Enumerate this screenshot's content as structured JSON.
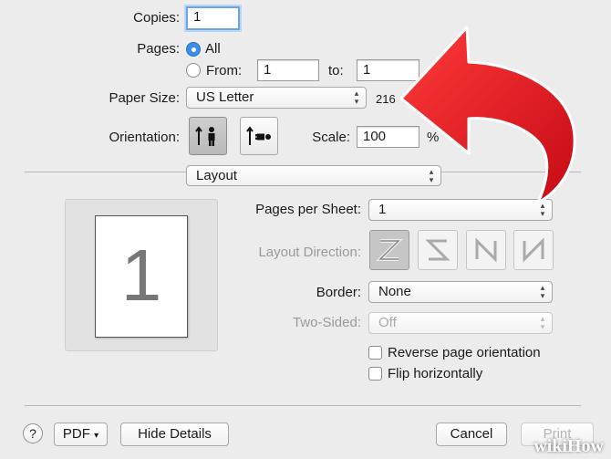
{
  "copies": {
    "label": "Copies:",
    "value": "1"
  },
  "pages": {
    "label": "Pages:",
    "all_label": "All",
    "from_label": "From:",
    "from_value": "1",
    "to_label": "to:",
    "to_value": "1"
  },
  "paper_size": {
    "label": "Paper Size:",
    "value": "US Letter",
    "dims_text": "216"
  },
  "orientation": {
    "label": "Orientation:",
    "selected": "portrait"
  },
  "scale": {
    "label": "Scale:",
    "value": "100",
    "unit": "%"
  },
  "section_popup": {
    "value": "Layout"
  },
  "preview": {
    "page_number": "1"
  },
  "layout": {
    "pages_per_sheet": {
      "label": "Pages per Sheet:",
      "value": "1"
    },
    "layout_direction": {
      "label": "Layout Direction:"
    },
    "border": {
      "label": "Border:",
      "value": "None"
    },
    "two_sided": {
      "label": "Two-Sided:",
      "value": "Off"
    },
    "reverse": {
      "label": "Reverse page orientation",
      "checked": false
    },
    "flip": {
      "label": "Flip horizontally",
      "checked": false
    }
  },
  "footer": {
    "help_label": "?",
    "pdf_label": "PDF",
    "hide_details_label": "Hide Details",
    "cancel_label": "Cancel",
    "print_label": "Print"
  },
  "watermark": "wikiHow",
  "colors": {
    "accent_blue": "#3d8ee8",
    "arrow_red": "#e3101c",
    "background": "#ececec"
  }
}
